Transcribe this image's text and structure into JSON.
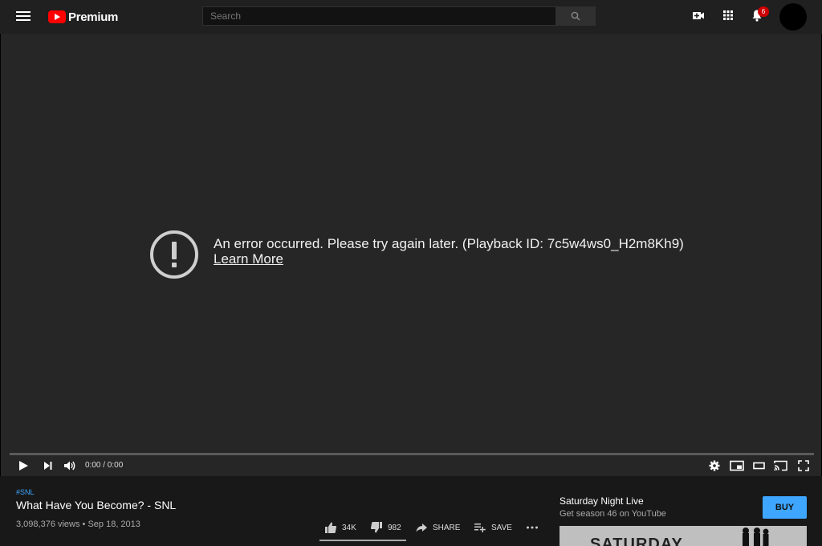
{
  "header": {
    "brand": "Premium",
    "search_placeholder": "Search",
    "notification_count": "6",
    "icons": [
      "menu-icon",
      "youtube-logo-icon",
      "search-icon",
      "create-video-icon",
      "apps-grid-icon",
      "notification-bell-icon"
    ]
  },
  "player": {
    "error_message": "An error occurred. Please try again later. (Playback ID: 7c5w4ws0_H2m8Kh9)",
    "learn_more": "Learn More",
    "time": "0:00 / 0:00",
    "controls": [
      "play-icon",
      "next-icon",
      "volume-icon",
      "settings-icon",
      "miniplayer-icon",
      "theater-mode-icon",
      "cast-icon",
      "fullscreen-icon"
    ]
  },
  "video": {
    "hashtag": "#SNL",
    "title": "What Have You Become? - SNL",
    "meta": "3,098,376 views • Sep 18, 2013",
    "likes": "34K",
    "dislikes": "982",
    "share_label": "SHARE",
    "save_label": "SAVE"
  },
  "promo": {
    "title": "Saturday Night Live",
    "subtitle": "Get season 46 on YouTube",
    "buy_label": "BUY",
    "thumbnail_text": "SATURDAY"
  },
  "colors": {
    "brand_red": "#ff0000",
    "accent_blue": "#3ea6ff",
    "badge_red": "#cc0000",
    "bg": "#181818",
    "player_bg": "#262626"
  }
}
